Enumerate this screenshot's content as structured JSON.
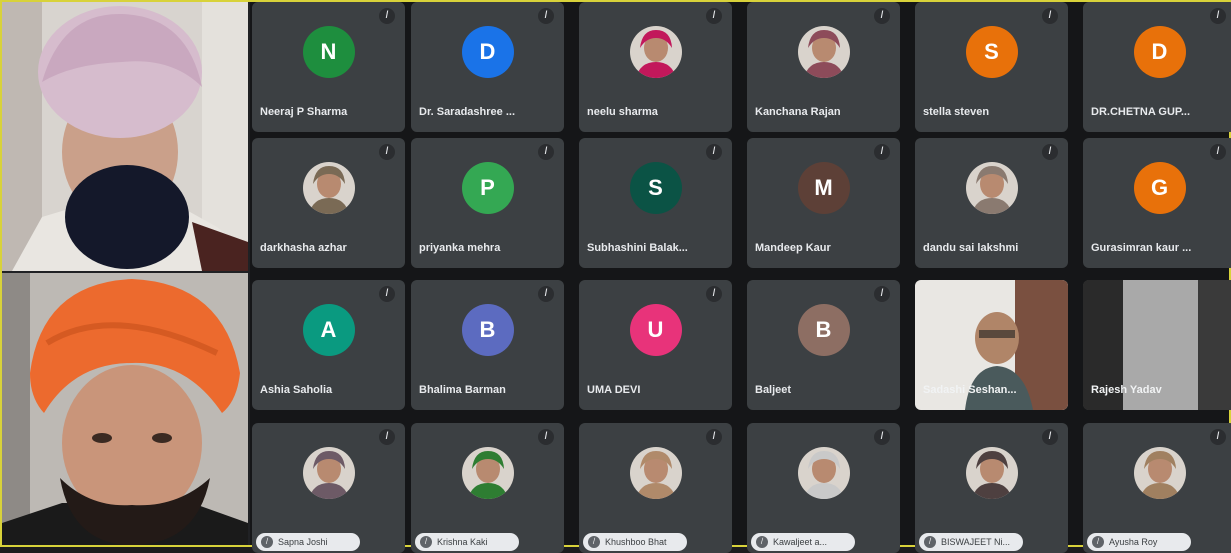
{
  "speakers": [
    {
      "id": "speaker-1"
    },
    {
      "id": "speaker-2"
    }
  ],
  "grid": {
    "mic_glyph": "̸",
    "rows": [
      [
        {
          "name": "Neeraj P Sharma",
          "initial": "N",
          "color": "#1e8e3e",
          "kind": "letter"
        },
        {
          "name": "Dr. Saradashree ...",
          "initial": "D",
          "color": "#1a73e8",
          "kind": "letter"
        },
        {
          "name": "neelu sharma",
          "initial": "",
          "color": "#c2185b",
          "kind": "photo"
        },
        {
          "name": "Kanchana Rajan",
          "initial": "",
          "color": "#8d4b5a",
          "kind": "photo"
        },
        {
          "name": "stella steven",
          "initial": "S",
          "color": "#e8710a",
          "kind": "letter"
        },
        {
          "name": "DR.CHETNA GUP...",
          "initial": "D",
          "color": "#e8710a",
          "kind": "letter"
        }
      ],
      [
        {
          "name": "darkhasha azhar",
          "initial": "",
          "color": "#7a6a55",
          "kind": "photo"
        },
        {
          "name": "priyanka mehra",
          "initial": "P",
          "color": "#34a853",
          "kind": "letter"
        },
        {
          "name": "Subhashini Balak...",
          "initial": "S",
          "color": "#0b5345",
          "kind": "letter"
        },
        {
          "name": "Mandeep Kaur",
          "initial": "M",
          "color": "#5d4037",
          "kind": "letter"
        },
        {
          "name": "dandu sai lakshmi",
          "initial": "",
          "color": "#8a7a70",
          "kind": "photo"
        },
        {
          "name": "Gurasimran kaur ...",
          "initial": "G",
          "color": "#e8710a",
          "kind": "letter"
        }
      ],
      [
        {
          "name": "Ashia Saholia",
          "initial": "A",
          "color": "#0a9a80",
          "kind": "letter"
        },
        {
          "name": "Bhalima Barman",
          "initial": "B",
          "color": "#5c6bc0",
          "kind": "letter"
        },
        {
          "name": "UMA DEVI",
          "initial": "U",
          "color": "#e8337a",
          "kind": "letter"
        },
        {
          "name": "Baljeet",
          "initial": "B",
          "color": "#8d6e63",
          "kind": "letter"
        },
        {
          "name": "Sadashi Seshan...",
          "initial": "",
          "color": "#9e9e9e",
          "kind": "video"
        },
        {
          "name": "Rajesh Yadav",
          "initial": "",
          "color": "#6d6d6d",
          "kind": "video"
        }
      ],
      [
        {
          "name": "Sapna Joshi",
          "initial": "",
          "color": "#6d5a66",
          "kind": "pill"
        },
        {
          "name": "Krishna Kaki",
          "initial": "",
          "color": "#2e7d32",
          "kind": "pill"
        },
        {
          "name": "Khushboo Bhat",
          "initial": "",
          "color": "#b08a6a",
          "kind": "pill"
        },
        {
          "name": "Kawaljeet a...",
          "initial": "",
          "color": "#c9c9c9",
          "kind": "pill"
        },
        {
          "name": "BISWAJEET Ni...",
          "initial": "",
          "color": "#4e4040",
          "kind": "pill"
        },
        {
          "name": "Ayusha Roy",
          "initial": "",
          "color": "#a08060",
          "kind": "pill"
        }
      ]
    ]
  }
}
